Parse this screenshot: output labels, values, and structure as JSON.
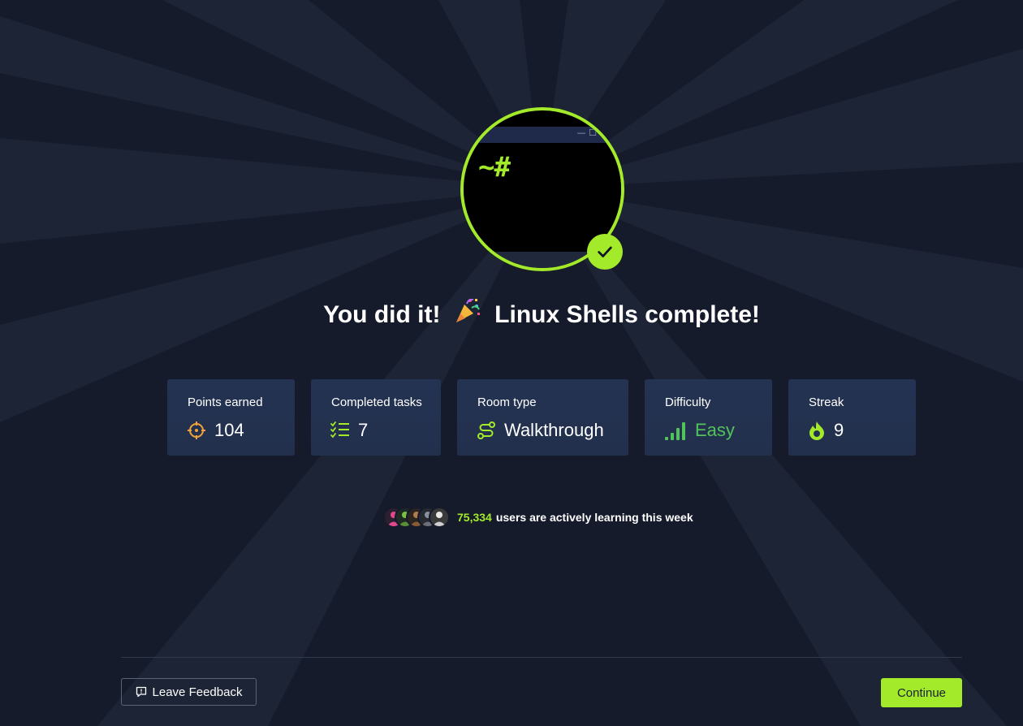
{
  "heading": {
    "prefix": "You did it!",
    "suffix": "Linux Shells complete!"
  },
  "badge": {
    "prompt": "~#",
    "window_controls": "— ☐",
    "accent_color": "#a3ea2a"
  },
  "stats": [
    {
      "label": "Points earned",
      "value": "104",
      "icon": "crosshair-icon"
    },
    {
      "label": "Completed tasks",
      "value": "7",
      "icon": "task-list-icon"
    },
    {
      "label": "Room type",
      "value": "Walkthrough",
      "icon": "route-icon"
    },
    {
      "label": "Difficulty",
      "value": "Easy",
      "icon": "signal-bars-icon",
      "color": "#52c35a"
    },
    {
      "label": "Streak",
      "value": "9",
      "icon": "flame-icon"
    }
  ],
  "activity": {
    "count": "75,334",
    "text": "users are actively learning this week"
  },
  "footer": {
    "feedback_label": "Leave Feedback",
    "continue_label": "Continue"
  },
  "colors": {
    "background": "#161b2b",
    "card": "#243352",
    "accent": "#a3ea2a",
    "points_icon": "#f0a33a",
    "easy": "#52c35a"
  }
}
